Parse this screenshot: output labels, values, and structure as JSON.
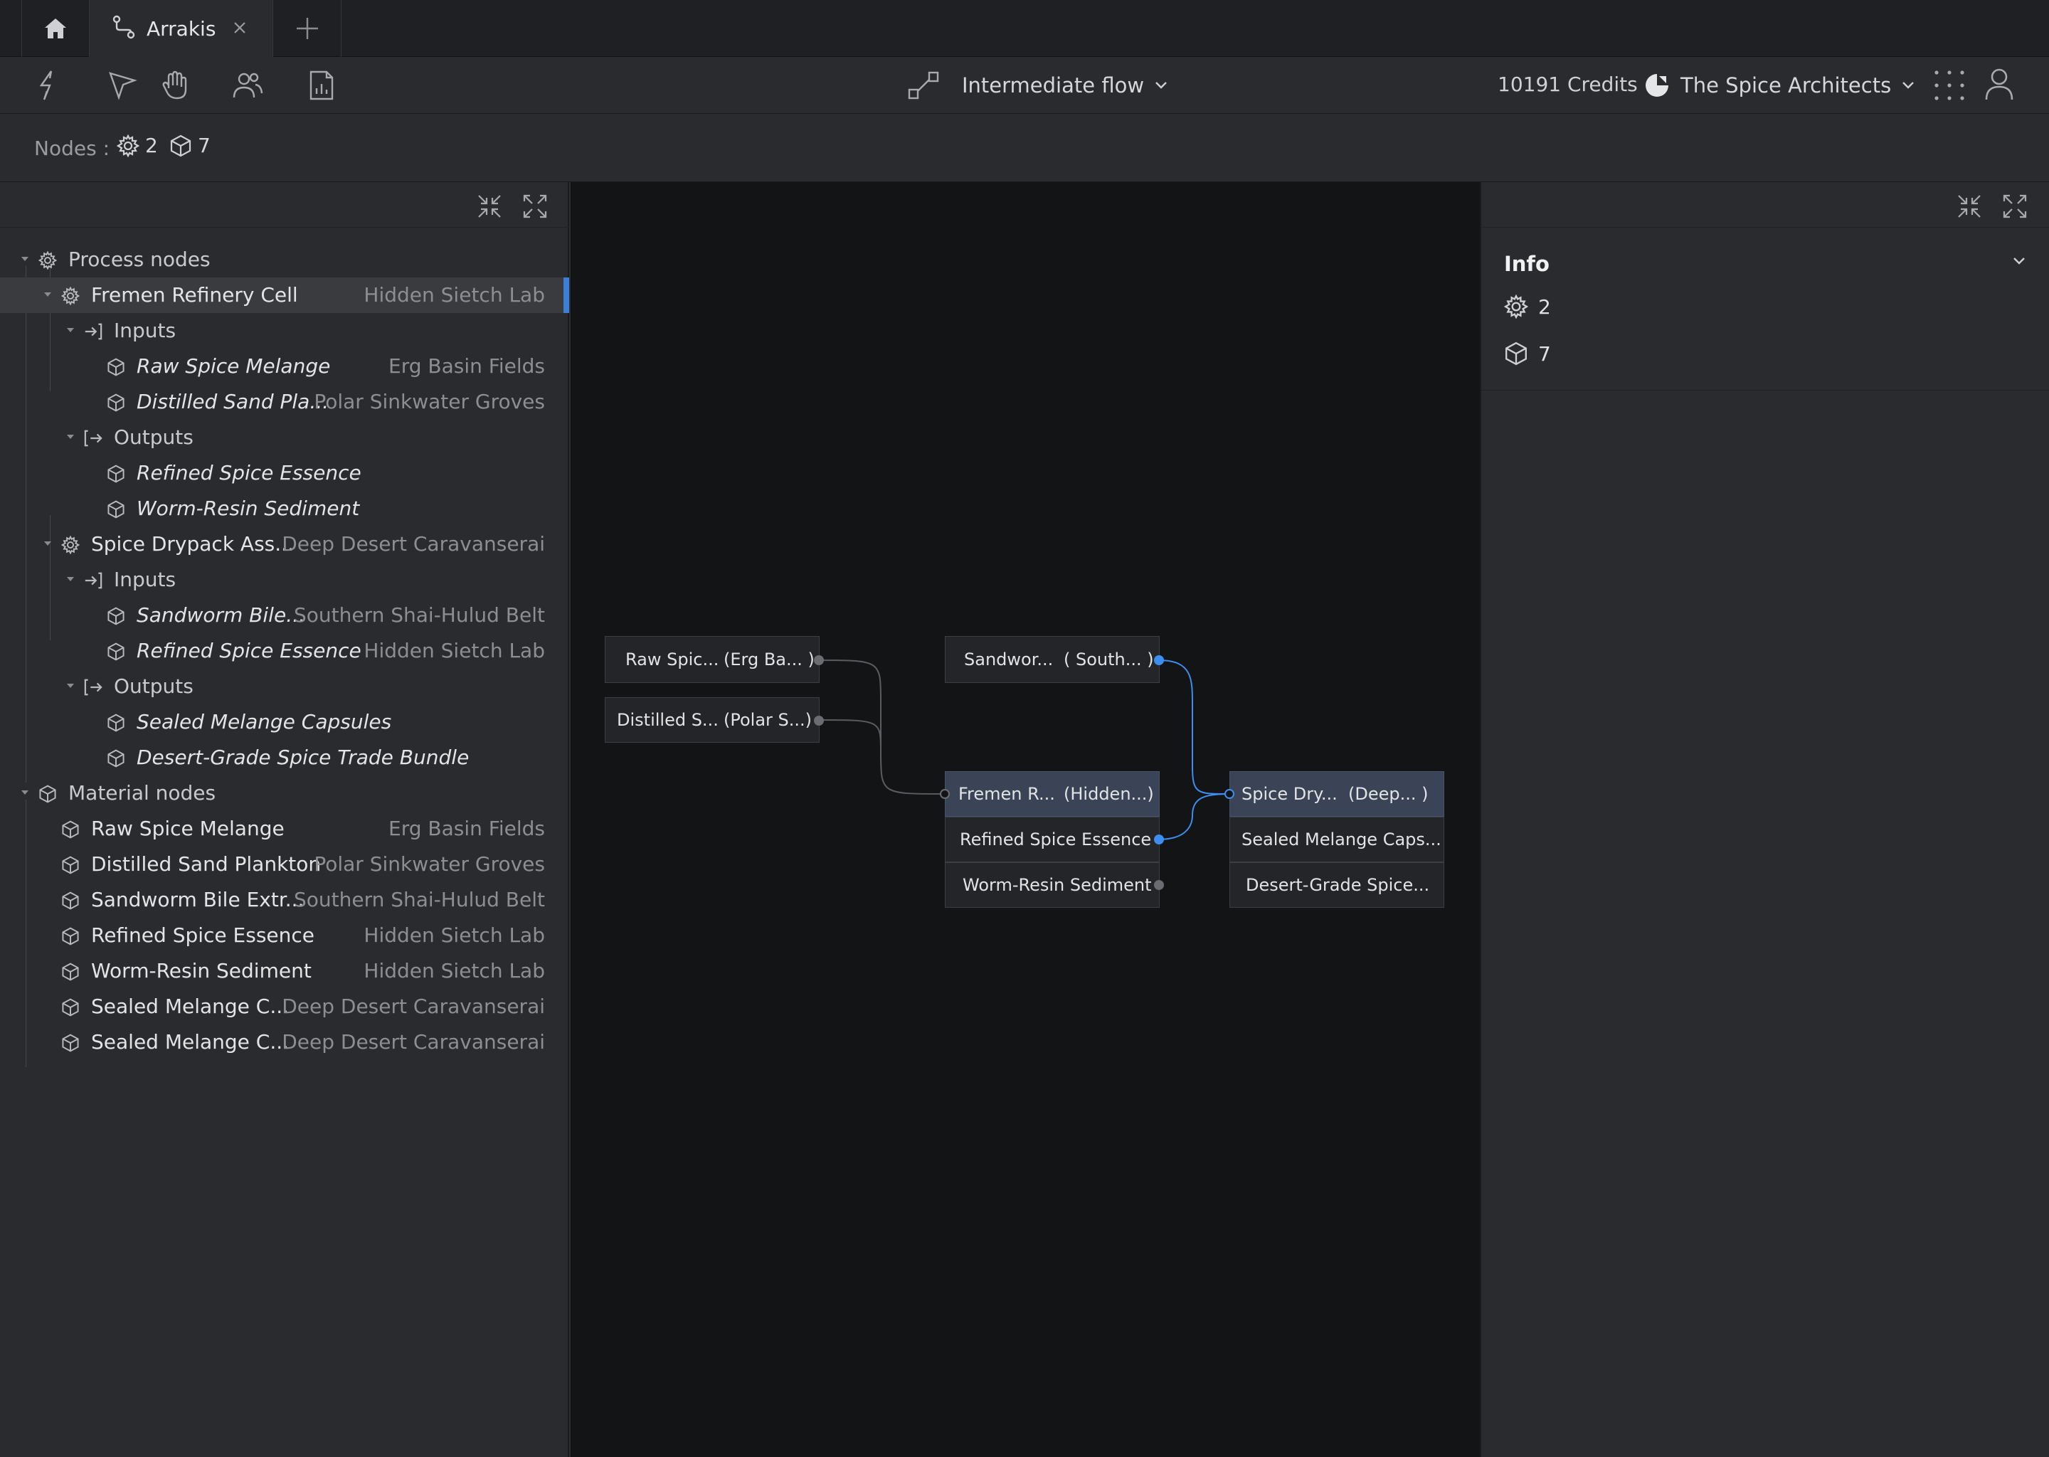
{
  "tabs": {
    "home_icon": "home-icon",
    "active_title": "Arrakis",
    "close_icon": "close-icon",
    "add_icon": "plus-icon"
  },
  "toolbar": {
    "tools": [
      "lightning-icon",
      "pointer-icon",
      "hand-icon",
      "users-icon",
      "report-icon"
    ],
    "flow_select": "Intermediate flow",
    "credits": "10191 Credits",
    "org_name": "The Spice Architects"
  },
  "nodes_bar": {
    "label": "Nodes :",
    "process_count": "2",
    "material_count": "7"
  },
  "tree": {
    "process_header": "Process nodes",
    "material_header": "Material nodes",
    "inputs_label": "Inputs",
    "outputs_label": "Outputs",
    "p1": {
      "name": "Fremen Refinery Cell",
      "loc": "Hidden Sietch Lab",
      "inputs": [
        {
          "name": "Raw Spice Melange",
          "loc": "Erg Basin Fields"
        },
        {
          "name": "Distilled Sand Pla...",
          "loc": "Polar Sinkwater Groves"
        }
      ],
      "outputs": [
        {
          "name": "Refined Spice Essence"
        },
        {
          "name": "Worm-Resin Sediment"
        }
      ]
    },
    "p2": {
      "name": "Spice Drypack Ass...",
      "loc": "Deep Desert Caravanserai",
      "inputs": [
        {
          "name": "Sandworm Bile...",
          "loc": "Southern Shai-Hulud Belt"
        },
        {
          "name": "Refined Spice Essence",
          "loc": "Hidden Sietch Lab"
        }
      ],
      "outputs": [
        {
          "name": "Sealed Melange Capsules"
        },
        {
          "name": "Desert-Grade Spice Trade Bundle"
        }
      ]
    },
    "materials": [
      {
        "name": "Raw Spice Melange",
        "loc": "Erg Basin Fields"
      },
      {
        "name": "Distilled Sand Plankton",
        "loc": "Polar Sinkwater Groves"
      },
      {
        "name": "Sandworm Bile Extr...",
        "loc": "Southern Shai-Hulud Belt"
      },
      {
        "name": "Refined Spice Essence",
        "loc": "Hidden Sietch Lab"
      },
      {
        "name": "Worm-Resin Sediment",
        "loc": "Hidden Sietch Lab"
      },
      {
        "name": "Sealed Melange C...",
        "loc": "Deep Desert Caravanserai"
      },
      {
        "name": "Sealed Melange C...",
        "loc": "Deep Desert Caravanserai"
      }
    ]
  },
  "graph": {
    "raw_spice": {
      "a": "Raw Spic...",
      "b": "(Erg Ba... )"
    },
    "distilled": {
      "a": "Distilled S...",
      "b": "(Polar S...)"
    },
    "sandworm": {
      "a": "Sandwor...",
      "b": "( South... )"
    },
    "fremen": {
      "a": "Fremen R...",
      "b": "(Hidden...)"
    },
    "fremen_out1": "Refined Spice Essence",
    "fremen_out2": "Worm-Resin Sediment",
    "drypack": {
      "a": "Spice Dry...",
      "b": "(Deep...   )"
    },
    "drypack_out1": "Sealed Melange Caps...",
    "drypack_out2": "Desert-Grade Spice..."
  },
  "info": {
    "title": "Info",
    "process_count": "2",
    "material_count": "7"
  },
  "colors": {
    "accent": "#3d8ef0",
    "selected_bar": "#3d7fd6",
    "canvas_bg": "#131416",
    "panel_bg": "#2a2b2e"
  }
}
